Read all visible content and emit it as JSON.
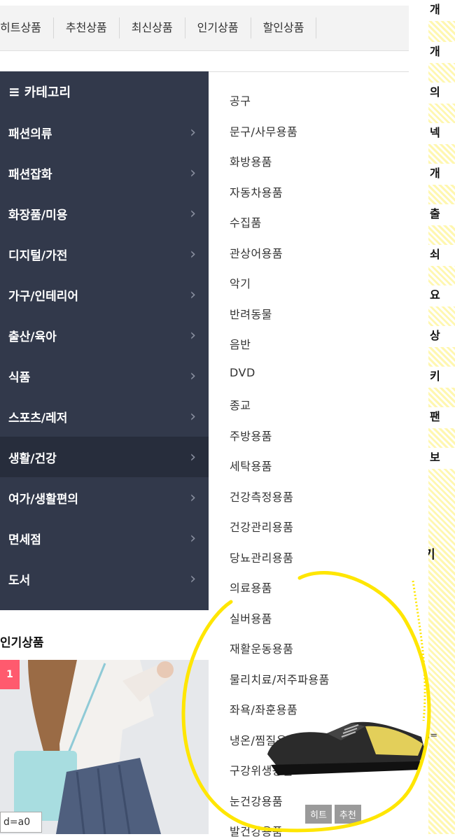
{
  "top_tabs": [
    "히트상품",
    "추천상품",
    "최신상품",
    "인기상품",
    "할인상품"
  ],
  "category_menu": {
    "header": "카테고리",
    "items": [
      {
        "label": "패션의류",
        "active": false
      },
      {
        "label": "패션잡화",
        "active": false
      },
      {
        "label": "화장품/미용",
        "active": false
      },
      {
        "label": "디지털/가전",
        "active": false
      },
      {
        "label": "가구/인테리어",
        "active": false
      },
      {
        "label": "출산/육아",
        "active": false
      },
      {
        "label": "식품",
        "active": false
      },
      {
        "label": "스포츠/레저",
        "active": false
      },
      {
        "label": "생활/건강",
        "active": true
      },
      {
        "label": "여가/생활편의",
        "active": false
      },
      {
        "label": "면세점",
        "active": false
      },
      {
        "label": "도서",
        "active": false
      }
    ]
  },
  "submenu": [
    "공구",
    "문구/사무용품",
    "화방용품",
    "자동차용품",
    "수집품",
    "관상어용품",
    "악기",
    "반려동물",
    "음반",
    "DVD",
    "종교",
    "주방용품",
    "세탁용품",
    "건강측정용품",
    "건강관리용품",
    "당뇨관리용품",
    "의료용품",
    "실버용품",
    "재활운동용품",
    "물리치료/저주파용품",
    "좌욕/좌훈용품",
    "냉온/찜질용품",
    "구강위생용품",
    "눈건강용품",
    "발건강용품"
  ],
  "popular": {
    "title": "인기상품",
    "rank": "1",
    "code_tag": "d=a0"
  },
  "product_badges": [
    "히트",
    "추천"
  ],
  "right_strip": {
    "section_label": "기",
    "code_fragment": "d=",
    "items": [
      "개",
      "개",
      "의",
      "넥",
      "개",
      "출",
      "쇠",
      "요",
      "상",
      "키",
      "팬",
      "보"
    ]
  },
  "colors": {
    "menu_bg": "#32394b",
    "menu_active_bg": "#272d3c",
    "rank_badge": "#ff5a6e",
    "badge_gray": "#9a9a9a",
    "highlight_yellow": "#ffe600"
  }
}
